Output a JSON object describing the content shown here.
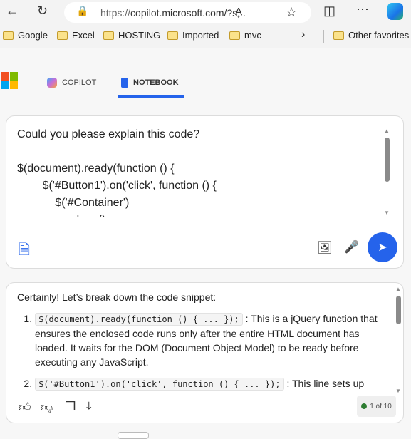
{
  "browser": {
    "url_prefix": "https://",
    "url_rest": "copilot.microsoft.com/?s...",
    "favorites": [
      "Google",
      "Excel",
      "HOSTING",
      "Imported",
      "mvc"
    ],
    "other_favorites": "Other favorites"
  },
  "tabs": [
    {
      "label": "COPILOT",
      "active": false
    },
    {
      "label": "NOTEBOOK",
      "active": true
    }
  ],
  "accent": "#2563eb",
  "prompt": {
    "text": "Could you please explain this code?\n\n$(document).ready(function () {\n        $('#Button1').on('click', function () {\n            $('#Container')\n                .clone()"
  },
  "response": {
    "intro": "Certainly! Let’s break down the code snippet:",
    "items": [
      {
        "code": "$(document).ready(function () { ... });",
        "text": ": This is a jQuery function that ensures the enclosed code runs only after the entire HTML document has loaded. It waits for the DOM (Document Object Model) to be ready before executing any JavaScript."
      },
      {
        "code": "$('#Button1').on('click', function () { ... });",
        "text": ": This line sets up"
      }
    ],
    "counter": "1 of 10"
  }
}
